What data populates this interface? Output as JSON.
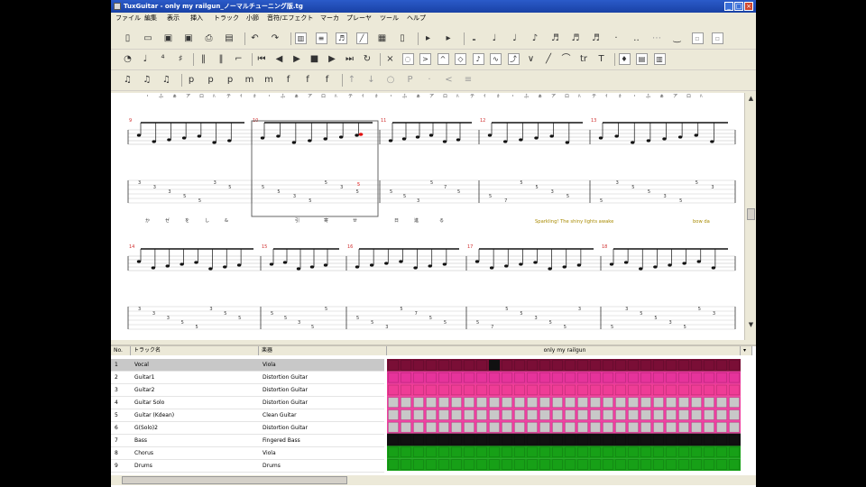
{
  "window": {
    "title": "TuxGuitar - only my railgun_ノーマルチューニング版.tg"
  },
  "menu": [
    "ファイル",
    "編集",
    "表示",
    "挿入",
    "トラック",
    "小節",
    "音符/エフェクト",
    "マーカ",
    "プレーヤ",
    "ツール",
    "ヘルプ"
  ],
  "icons": {
    "toolbar_row1": [
      "new-file-icon",
      "open-file-icon",
      "save-icon",
      "save-as-icon",
      "print-icon",
      "print-preview-icon",
      "undo-icon",
      "redo-icon",
      "layout-page-icon",
      "layout-linear-icon",
      "score-view-icon",
      "tablature-view-icon",
      "compact-view-icon",
      "chord-icon",
      "add-measure-icon",
      "remove-measure-icon",
      "whole-note-icon",
      "half-note-icon",
      "quarter-note-icon",
      "eighth-note-icon",
      "sixteenth-note-icon",
      "thirty-second-note-icon",
      "sixty-fourth-note-icon",
      "dotted-icon",
      "double-dotted-icon",
      "division-type-icon",
      "tied-note-icon",
      "voice-1-icon",
      "voice-2-icon"
    ],
    "toolbar_row2": [
      "metronome-icon",
      "tempo-icon",
      "time-signature-icon",
      "key-signature-icon",
      "repeat-open-icon",
      "repeat-close-icon",
      "alternative-ending-icon",
      "first-measure-icon",
      "prev-measure-icon",
      "play-icon",
      "stop-icon",
      "next-measure-icon",
      "last-measure-icon",
      "loop-icon",
      "dead-note-icon",
      "ghost-note-icon",
      "accentuated-note-icon",
      "heavy-accent-icon",
      "harmonic-icon",
      "grace-note-icon",
      "vibrato-icon",
      "bend-icon",
      "tremolo-bar-icon",
      "slide-icon",
      "hammer-icon",
      "trill-icon",
      "tapping-icon",
      "mic-icon",
      "fretboard-icon",
      "piano-icon"
    ],
    "toolbar_row3": [
      "triplet-feel-none-icon",
      "triplet-feel-eighth-icon",
      "triplet-feel-sixteenth-icon",
      "dynamic-ppp-icon",
      "dynamic-pp-icon",
      "dynamic-p-icon",
      "dynamic-mp-icon",
      "dynamic-mf-icon",
      "dynamic-f-icon",
      "dynamic-ff-icon",
      "dynamic-fff-icon",
      "stroke-up-icon",
      "stroke-down-icon",
      "let-ring-icon",
      "palm-mute-icon",
      "staccato-icon",
      "fade-in-icon",
      "tremolo-picking-icon"
    ]
  },
  "track_table": {
    "headers": [
      "No.",
      "トラック名",
      "楽器"
    ],
    "song_name": "only my railgun",
    "tracks": [
      {
        "no": "1",
        "name": "Vocal",
        "instrument": "Viola",
        "color": "#7a0e36"
      },
      {
        "no": "2",
        "name": "Guitar1",
        "instrument": "Distortion Guitar",
        "color": "#e6339b"
      },
      {
        "no": "3",
        "name": "Guitar2",
        "instrument": "Distortion Guitar",
        "color": "#ef3c96"
      },
      {
        "no": "4",
        "name": "Guitar Solo",
        "instrument": "Distortion Guitar",
        "color": "#ee3ea0"
      },
      {
        "no": "5",
        "name": "Guitar (Kdean)",
        "instrument": "Clean Guitar",
        "color": "#ee3ea0"
      },
      {
        "no": "6",
        "name": "G(Solo)2",
        "instrument": "Distortion Guitar",
        "color": "#ee3ea0"
      },
      {
        "no": "7",
        "name": "Bass",
        "instrument": "Fingered Bass",
        "color": "#111111"
      },
      {
        "no": "8",
        "name": "Chorus",
        "instrument": "Viola",
        "color": "#17a017"
      },
      {
        "no": "9",
        "name": "Drums",
        "instrument": "Drums",
        "color": "#17a017"
      }
    ]
  },
  "score": {
    "lyric_line_1": "Sparkling!  The  shiny  lights  awake",
    "lyric_line_1_tail": "bow  da",
    "measure_numbers": [
      "9",
      "10",
      "11",
      "12",
      "13",
      "14",
      "15",
      "16",
      "17",
      "18"
    ],
    "tab_frets": [
      "3",
      "3",
      "3",
      "5",
      "5",
      "3",
      "5",
      "5",
      "3",
      "5",
      "7",
      "5",
      "5",
      "3",
      "5",
      "5",
      "3",
      "5",
      "5",
      "3"
    ]
  },
  "colors": {
    "titlebar": "#1f4fb5",
    "selected_row": "#c8c8c8",
    "cursor_note": "#e01010",
    "lyric_highlight": "#a88a00"
  }
}
